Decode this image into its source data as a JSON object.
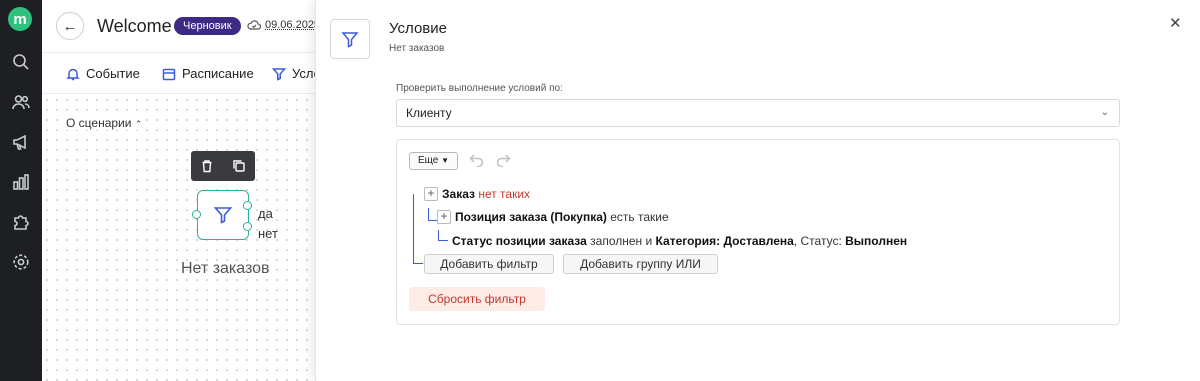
{
  "header": {
    "title": "Welcome",
    "status_badge": "Черновик",
    "date": "09.06.2025"
  },
  "tabs": [
    {
      "label": "Событие",
      "icon": "bell-icon"
    },
    {
      "label": "Расписание",
      "icon": "calendar-icon"
    },
    {
      "label": "Усло",
      "icon": "filter-icon"
    }
  ],
  "canvas": {
    "about_label": "О сценарии",
    "node_label": "Нет заказов",
    "yes_label": "да",
    "no_label": "нет"
  },
  "panel": {
    "title": "Условие",
    "subtitle": "Нет заказов",
    "check_label": "Проверить выполнение условий по:",
    "check_value": "Клиенту",
    "more_label": "Еще",
    "conditions": {
      "row1": {
        "entity": "Заказ",
        "state": "нет таких"
      },
      "row2": {
        "entity": "Позиция заказа (Покупка)",
        "state": "есть такие"
      },
      "row3": {
        "field": "Статус позиции заказа",
        "state": "заполнен и",
        "category_label": "Категория:",
        "category_value": "Доставлена",
        "status_label": ", Статус:",
        "status_value": "Выполнен"
      }
    },
    "add_filter_label": "Добавить фильтр",
    "add_group_label": "Добавить группу ИЛИ",
    "reset_label": "Сбросить фильтр"
  },
  "colors": {
    "accent": "#3d5ad8",
    "badge": "#3d2a84",
    "node_border": "#2cb39a",
    "danger": "#c0392b",
    "rail": "#1e1f22"
  }
}
